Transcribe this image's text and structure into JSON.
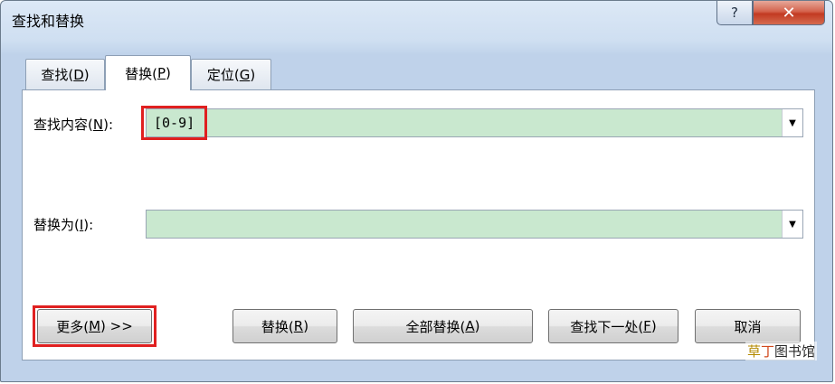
{
  "window": {
    "title": "查找和替换",
    "help": "?",
    "close": "✕"
  },
  "tabs": [
    {
      "label": "查找(",
      "key": "D",
      "end": ")",
      "active": false
    },
    {
      "label": "替换(",
      "key": "P",
      "end": ")",
      "active": true
    },
    {
      "label": "定位(",
      "key": "G",
      "end": ")",
      "active": false
    }
  ],
  "find": {
    "label": "查找内容(",
    "key": "N",
    "end": "):",
    "value": "[0-9]"
  },
  "replace": {
    "label": "替换为(",
    "key": "I",
    "end": "):",
    "value": ""
  },
  "buttons": {
    "more": {
      "label": "更多(",
      "key": "M",
      "end": ") >>"
    },
    "replace": {
      "label": "替换(",
      "key": "R",
      "end": ")"
    },
    "replace_all": {
      "label": "全部替换(",
      "key": "A",
      "end": ")"
    },
    "find_next": {
      "label": "查找下一处(",
      "key": "F",
      "end": ")"
    },
    "cancel": {
      "label": "取消"
    }
  },
  "watermark": {
    "part1": "草",
    "part2": "丁",
    "part3": "图书馆"
  },
  "colors": {
    "field_bg": "#c9e8cf",
    "highlight": "#e02020",
    "frame": "#cfdff1"
  }
}
